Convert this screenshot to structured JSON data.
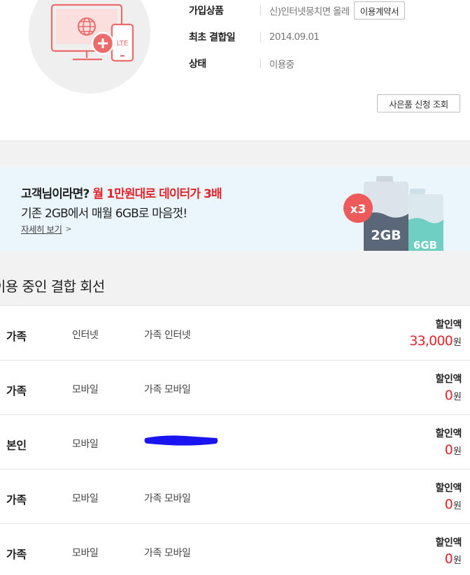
{
  "summary": {
    "product_label": "가입상품",
    "product_value": "신)인터넷뭉치면 올레",
    "contract_button": "이용계약서",
    "first_join_label": "최초 결합일",
    "first_join_value": "2014.09.01",
    "status_label": "상태",
    "status_value": "이용중",
    "gift_button": "사은품 신청 조회",
    "device_badge": "LTE"
  },
  "banner": {
    "line1_prefix": "고객님이라면?",
    "line1_highlight": "월 1만원대로 데이터가 3배",
    "line2": "기존 2GB에서 매월 6GB로 마음껏!",
    "link": "자세히 보기",
    "multiplier": "x3",
    "battery_small": "2GB",
    "battery_large": "6GB"
  },
  "section_title": "이용 중인 결합 회선",
  "discount_label": "할인액",
  "currency_unit": "원",
  "members": [
    {
      "relation": "가족",
      "service": "인터넷",
      "description": "가족 인터넷",
      "discount": "33,000"
    },
    {
      "relation": "가족",
      "service": "모바일",
      "description": "가족 모바일",
      "discount": "0"
    },
    {
      "relation": "본인",
      "service": "모바일",
      "description": "",
      "discount": "0"
    },
    {
      "relation": "가족",
      "service": "모바일",
      "description": "가족 모바일",
      "discount": "0"
    },
    {
      "relation": "가족",
      "service": "모바일",
      "description": "가족 모바일",
      "discount": "0"
    }
  ],
  "colors": {
    "accent_red": "#e6242b",
    "icon_coral": "#ee6b6b",
    "banner_bg": "#eaf6fb",
    "redaction_blue": "#1a14f0"
  }
}
